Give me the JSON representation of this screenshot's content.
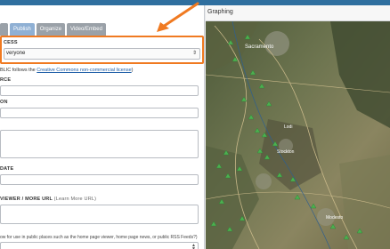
{
  "tabs": [
    "",
    "Publish",
    "Organize",
    "Video/Embed"
  ],
  "access": {
    "label": "CESS",
    "value": "veryone"
  },
  "license": {
    "prefix": "BLIC follows the ",
    "link": "Creative Commons non-commercial license",
    "suffix": ")"
  },
  "fields": {
    "source_label": "RCE",
    "location_label": "ON",
    "date_label": "DATE",
    "viewer_label": "VIEWER / MORE URL",
    "viewer_hint": "(Learn More URL)"
  },
  "public_use_text": "ow for use in public places such as the home page viewer, home page news, or public RSS Feeds?)",
  "map": {
    "title": "Graphing",
    "cities": [
      "Sacramento",
      "Stockton",
      "Modesto",
      "Lodi"
    ]
  },
  "colors": {
    "header": "#2f6f9f",
    "highlight": "#f07a21",
    "link": "#1f5fa8",
    "marker": "#4caf50"
  }
}
